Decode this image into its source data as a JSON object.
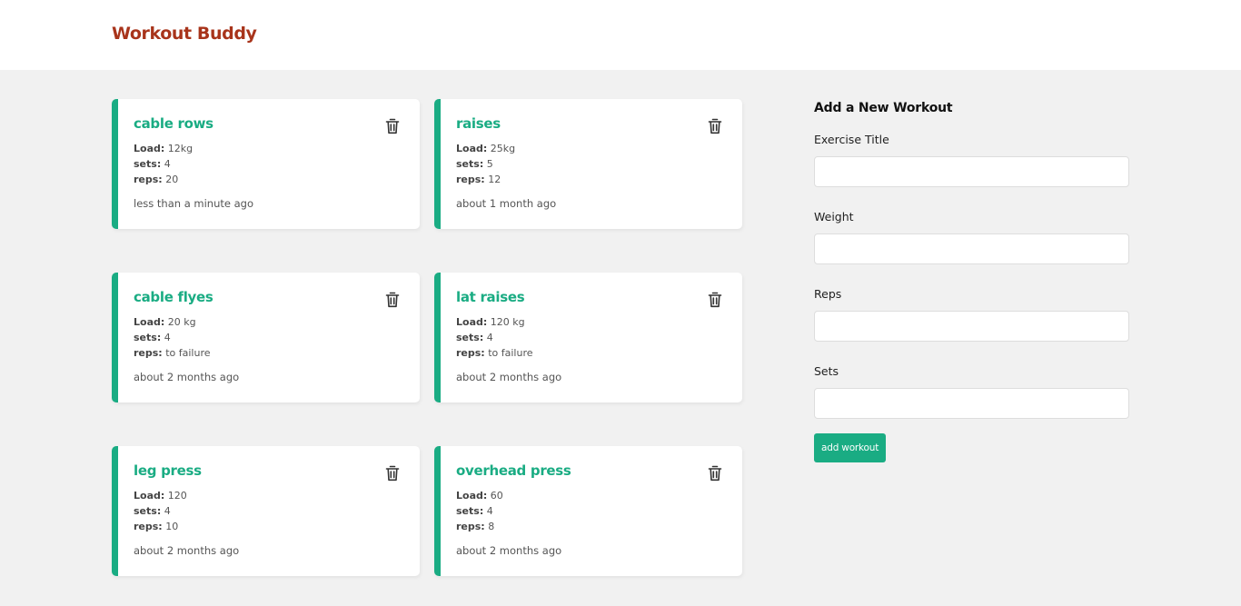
{
  "header": {
    "brand": "Workout Buddy"
  },
  "workouts": [
    {
      "title": "cable rows",
      "load_label": "Load:",
      "load": "12kg",
      "sets_label": "sets:",
      "sets": "4",
      "reps_label": "reps:",
      "reps": "20",
      "created": "less than a minute ago"
    },
    {
      "title": "raises",
      "load_label": "Load:",
      "load": "25kg",
      "sets_label": "sets:",
      "sets": "5",
      "reps_label": "reps:",
      "reps": "12",
      "created": "about 1 month ago"
    },
    {
      "title": "cable flyes",
      "load_label": "Load:",
      "load": "20 kg",
      "sets_label": "sets:",
      "sets": "4",
      "reps_label": "reps:",
      "reps": "to failure",
      "created": "about 2 months ago"
    },
    {
      "title": "lat raises",
      "load_label": "Load:",
      "load": "120 kg",
      "sets_label": "sets:",
      "sets": "4",
      "reps_label": "reps:",
      "reps": "to failure",
      "created": "about 2 months ago"
    },
    {
      "title": "leg press",
      "load_label": "Load:",
      "load": "120",
      "sets_label": "sets:",
      "sets": "4",
      "reps_label": "reps:",
      "reps": "10",
      "created": "about 2 months ago"
    },
    {
      "title": "overhead press",
      "load_label": "Load:",
      "load": "60",
      "sets_label": "sets:",
      "sets": "4",
      "reps_label": "reps:",
      "reps": "8",
      "created": "about 2 months ago"
    }
  ],
  "form": {
    "title": "Add a New Workout",
    "exercise_title_label": "Exercise Title",
    "exercise_title_value": "",
    "weight_label": "Weight",
    "weight_value": "",
    "reps_label": "Reps",
    "reps_value": "",
    "sets_label": "Sets",
    "sets_value": "",
    "submit_label": "add workout"
  },
  "icons": {
    "delete": "trash-icon"
  },
  "colors": {
    "brand": "#a8341b",
    "accent": "#1aac83",
    "background": "#f1f1f1"
  }
}
